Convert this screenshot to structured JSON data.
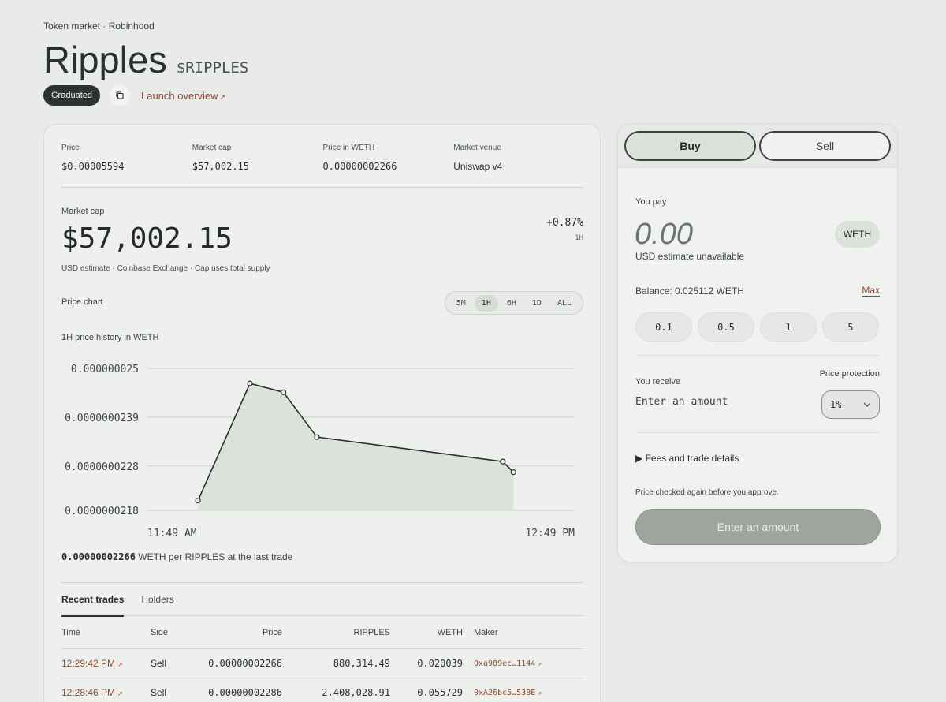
{
  "breadcrumb": "Token market · Robinhood",
  "token": {
    "name": "Ripples",
    "ticker": "$RIPPLES"
  },
  "badge": "Graduated",
  "launch_link": "Launch overview",
  "stats": [
    {
      "label": "Price",
      "value": "$0.00005594"
    },
    {
      "label": "Market cap",
      "value": "$57,002.15"
    },
    {
      "label": "Price in WETH",
      "value": "0.00000002266"
    },
    {
      "label": "Market venue",
      "value": "Uniswap v4"
    }
  ],
  "market_cap": {
    "label": "Market cap",
    "value": "$57,002.15",
    "change": "+0.87%",
    "period": "1H",
    "note": "USD estimate · Coinbase Exchange · Cap uses total supply"
  },
  "price_chart": {
    "label": "Price chart",
    "ranges": [
      "5M",
      "1H",
      "6H",
      "1D",
      "ALL"
    ],
    "active_range": "1H",
    "history_label": "1H price history in WETH"
  },
  "chart_data": {
    "type": "area",
    "title": "1H price history in WETH",
    "x_tick_labels": [
      "11:49 AM",
      "12:49 PM"
    ],
    "y_tick_labels": [
      "0.000000025",
      "0.0000000239",
      "0.0000000228",
      "0.0000000218"
    ],
    "y_ticks": [
      2.5e-08,
      2.39e-08,
      2.28e-08,
      2.18e-08
    ],
    "ylim": [
      2.18e-08,
      2.5e-08
    ],
    "x_minutes_range": [
      0,
      60
    ],
    "series": [
      {
        "x": [
          7.1,
          14.4,
          19.1,
          23.8,
          49.9,
          51.4
        ],
        "y": [
          2.202e-08,
          2.466e-08,
          2.446e-08,
          2.345e-08,
          2.29e-08,
          2.266e-08
        ]
      }
    ],
    "grid": true,
    "line_color": "#2a2f2b",
    "fill_color": "#dde1dc"
  },
  "last_trade": {
    "value": "0.00000002266",
    "suffix": "WETH per RIPPLES at the last trade"
  },
  "tabs": [
    "Recent trades",
    "Holders"
  ],
  "trades": {
    "headers": [
      "Time",
      "Side",
      "Price",
      "RIPPLES",
      "WETH",
      "Maker"
    ],
    "rows": [
      {
        "time": "12:29:42 PM",
        "side": "Sell",
        "price": "0.00000002266",
        "ripples": "880,314.49",
        "weth": "0.020039",
        "maker": "0xa989ec…1144"
      },
      {
        "time": "12:28:46 PM",
        "side": "Sell",
        "price": "0.00000002286",
        "ripples": "2,408,028.91",
        "weth": "0.055729",
        "maker": "0xA26bc5…538E"
      }
    ]
  },
  "trade_panel": {
    "buy": "Buy",
    "sell": "Sell",
    "pay_label": "You pay",
    "pay_amount": "0.00",
    "pay_token": "WETH",
    "usd_estimate": "USD estimate unavailable",
    "balance": "Balance: 0.025112 WETH",
    "max": "Max",
    "quick_amounts": [
      "0.1",
      "0.5",
      "1",
      "5"
    ],
    "receive_label": "You receive",
    "receive_placeholder": "Enter an amount",
    "protection_label": "Price protection",
    "slippage": "1%",
    "fees": "Fees and trade details",
    "checked_note": "Price checked again before you approve.",
    "cta": "Enter an amount"
  }
}
